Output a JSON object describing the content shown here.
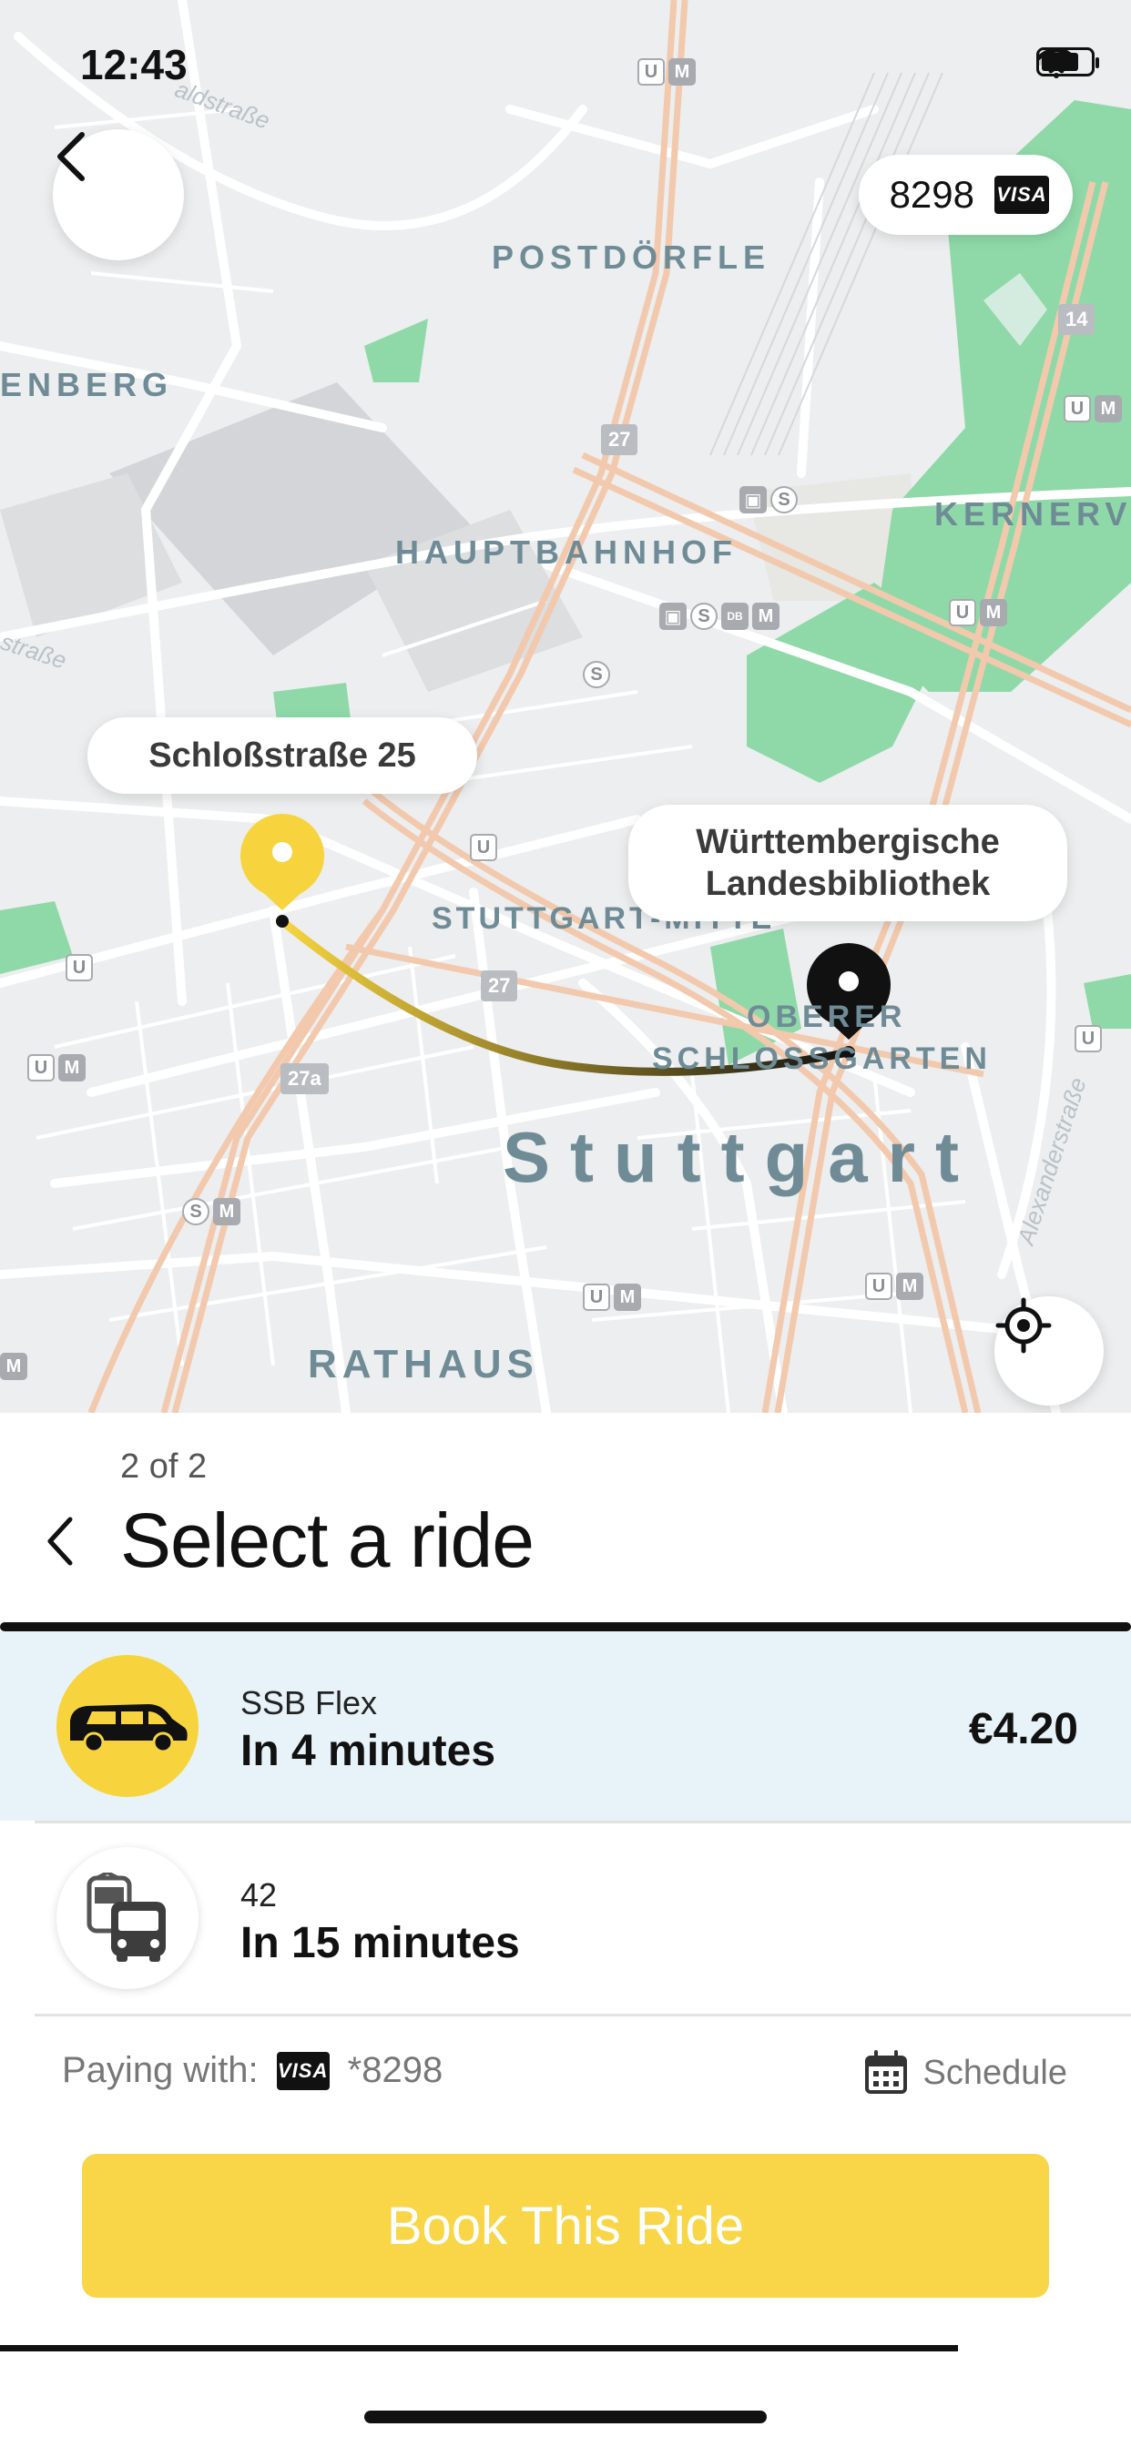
{
  "status_bar": {
    "time": "12:43"
  },
  "map": {
    "payment_pill": {
      "card_number": "8298",
      "card_brand": "VISA"
    },
    "origin_label": "Schloßstraße 25",
    "destination_label_line1": "Württembergische",
    "destination_label_line2": "Landesbibliothek",
    "labels": {
      "postdorfle": "POSTDÖRFLE",
      "enberg": "ENBERG",
      "hauptbahnhof": "HAUPTBAHNHOF",
      "kernervi": "KERNERVI",
      "stuttgart_mitte": "STUTTGART-MITTE",
      "oberer": "OBERER",
      "schlossgarten": "SCHLOSSGARTEN",
      "city": "Stuttgart",
      "rathaus": "RATHAUS",
      "road_1": "straße",
      "road_2": "Alexanderstraße",
      "road_3": "aldstraße"
    },
    "route_shields": [
      "27",
      "27",
      "27a",
      "14"
    ],
    "route_colors": {
      "origin": "#f7d43e",
      "destination": "#111111"
    }
  },
  "sheet": {
    "step": "2 of 2",
    "title": "Select a ride",
    "rides": [
      {
        "name": "SSB Flex",
        "eta": "In 4 minutes",
        "price": "€4.20",
        "icon": "van-icon",
        "selected": true
      },
      {
        "name": "42",
        "eta": "In 15 minutes",
        "price": "",
        "icon": "bus-icon",
        "selected": false
      }
    ],
    "paying_label": "Paying with:",
    "card_brand": "VISA",
    "card_masked": "*8298",
    "schedule_label": "Schedule",
    "book_button": "Book This Ride"
  },
  "colors": {
    "accent_yellow": "#f7d43e",
    "selected_row": "#e8f3f9",
    "park_green": "#8fd9a8",
    "road_orange": "#f2c9ad"
  }
}
